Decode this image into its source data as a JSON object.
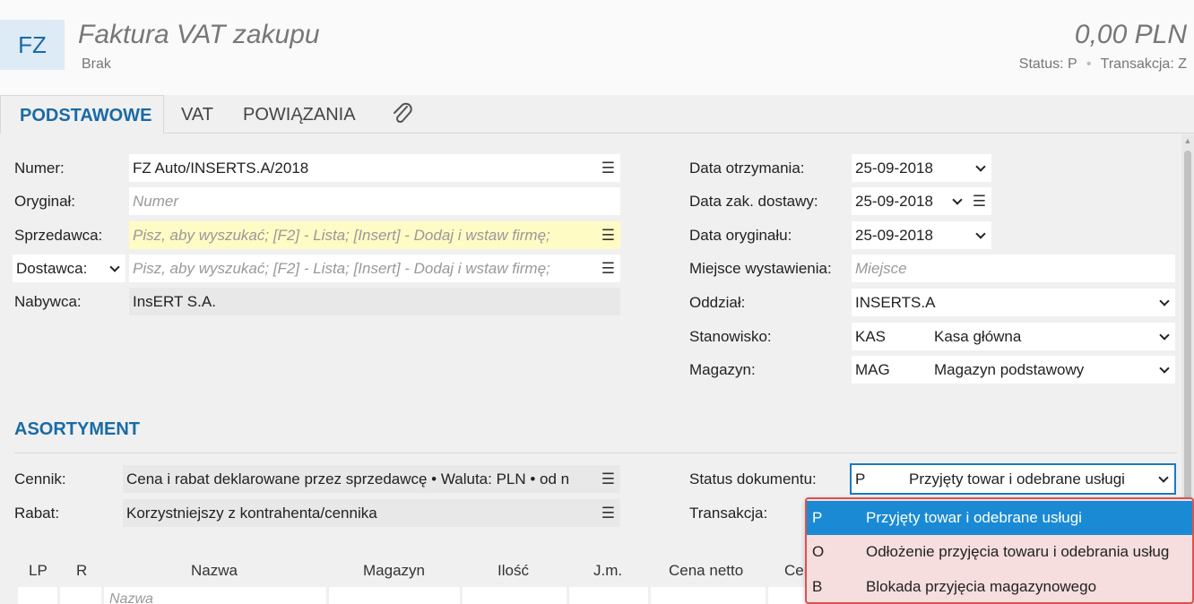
{
  "header": {
    "badge": "FZ",
    "title": "Faktura VAT zakupu",
    "subtitle": "Brak",
    "amount": "0,00 PLN",
    "status_label": "Status:",
    "status_value": "P",
    "transaction_label": "Transakcja:",
    "transaction_value": "Z"
  },
  "tabs": [
    {
      "label": "PODSTAWOWE",
      "active": true
    },
    {
      "label": "VAT",
      "active": false
    },
    {
      "label": "POWIĄZANIA",
      "active": false
    }
  ],
  "left_form": {
    "numer_label": "Numer:",
    "numer_value": "FZ Auto/INSERTS.A/2018",
    "oryginal_label": "Oryginał:",
    "oryginal_placeholder": "Numer",
    "sprzedawca_label": "Sprzedawca:",
    "sprzedawca_placeholder": "Pisz, aby wyszukać; [F2] - Lista; [Insert] - Dodaj i wstaw firmę;",
    "dostawca_label": "Dostawca:",
    "dostawca_placeholder": "Pisz, aby wyszukać; [F2] - Lista; [Insert] - Dodaj i wstaw firmę;",
    "nabywca_label": "Nabywca:",
    "nabywca_value": "InsERT S.A."
  },
  "right_form": {
    "data_otrzymania_label": "Data otrzymania:",
    "data_otrzymania_value": "25-09-2018",
    "data_dostawy_label": "Data zak. dostawy:",
    "data_dostawy_value": "25-09-2018",
    "data_oryginalu_label": "Data oryginału:",
    "data_oryginalu_value": "25-09-2018",
    "miejsce_label": "Miejsce wystawienia:",
    "miejsce_placeholder": "Miejsce",
    "oddzial_label": "Oddział:",
    "oddzial_value": "INSERTS.A",
    "stanowisko_label": "Stanowisko:",
    "stanowisko_code": "KAS",
    "stanowisko_name": "Kasa główna",
    "magazyn_label": "Magazyn:",
    "magazyn_code": "MAG",
    "magazyn_name": "Magazyn podstawowy"
  },
  "assortment": {
    "section_title": "ASORTYMENT",
    "cennik_label": "Cennik:",
    "cennik_value": "Cena i rabat deklarowane przez sprzedawcę • Waluta: PLN • od n",
    "rabat_label": "Rabat:",
    "rabat_value": "Korzystniejszy z kontrahenta/cennika",
    "status_label": "Status dokumentu:",
    "status_code": "P",
    "status_value": "Przyjęty towar i odebrane usługi",
    "transakcja_label": "Transakcja:"
  },
  "grid": {
    "headers": [
      "LP",
      "R",
      "Nazwa",
      "Magazyn",
      "Ilość",
      "J.m.",
      "Cena netto",
      "Cen"
    ],
    "new_row_placeholder": "Nazwa"
  },
  "status_dropdown": {
    "options": [
      {
        "code": "P",
        "label": "Przyjęty towar i odebrane usługi",
        "selected": true
      },
      {
        "code": "O",
        "label": "Odłożenie przyjęcia towaru i odebrania usług",
        "selected": false
      },
      {
        "code": "B",
        "label": "Blokada przyjęcia magazynowego",
        "selected": false
      }
    ]
  },
  "icons": {
    "menu": "hamburger-menu-icon",
    "chevron": "chevron-down-icon",
    "attachment": "paperclip-icon"
  },
  "colors": {
    "accent": "#1a6aa6",
    "selection": "#1a8ad4",
    "highlight_field": "#fffbc5",
    "dropdown_border": "#d9534f"
  }
}
